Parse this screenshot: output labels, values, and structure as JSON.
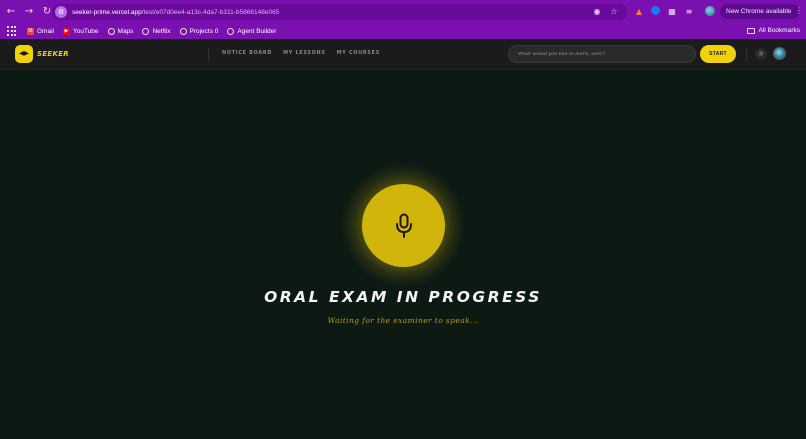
{
  "browser": {
    "url_host": "seeker-prime.vercel.app",
    "url_path": "/test/e07d0ee4-a13c-4da7-b311-b5866148e065",
    "update_label": "New Chrome available",
    "bookmarks": [
      {
        "label": "Gmail",
        "icon": "gmail-icon"
      },
      {
        "label": "YouTube",
        "icon": "youtube-icon"
      },
      {
        "label": "Maps",
        "icon": "globe-icon"
      },
      {
        "label": "Netflix",
        "icon": "globe-icon"
      },
      {
        "label": "Projects 0",
        "icon": "globe-icon"
      },
      {
        "label": "Agent Builder",
        "icon": "globe-icon"
      }
    ],
    "all_bookmarks_label": "All Bookmarks"
  },
  "app": {
    "logo_text": "SEEKER",
    "nav": [
      "NOTICE BOARD",
      "MY LESSONS",
      "MY COURSES"
    ],
    "search_placeholder": "What would you like to learn, Seer?",
    "start_label": "START"
  },
  "main": {
    "title": "ORAL EXAM IN PROGRESS",
    "subtitle": "Waiting for the examiner to speak...",
    "mic_icon": "microphone-icon"
  },
  "colors": {
    "browser_purple": "#7a10b0",
    "accent_yellow": "#f0d20a",
    "mic_yellow": "#d2b50a",
    "background": "#0d1a14",
    "header_bg": "#1b1b1b"
  }
}
